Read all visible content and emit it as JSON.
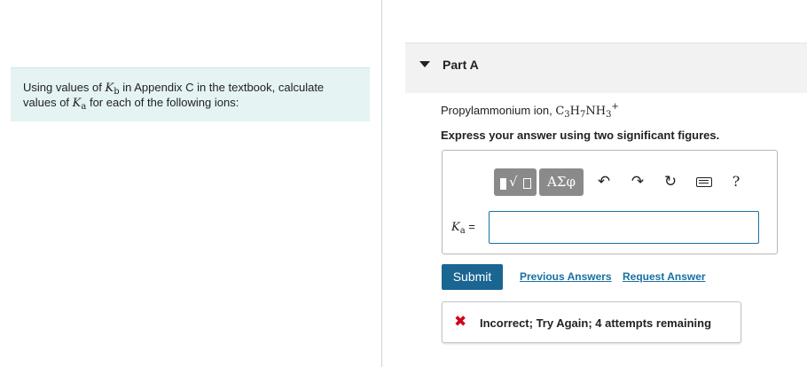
{
  "problem": {
    "text_before": "Using values of ",
    "kb_symbol": "K",
    "kb_subscript": "b",
    "text_middle": " in Appendix C in the textbook, calculate values of ",
    "ka_symbol": "K",
    "ka_subscript": "a",
    "text_after": " for each of the following ions:"
  },
  "part": {
    "title": "Part A",
    "question_prefix": "Propylammonium ion, ",
    "formula": {
      "c": "C",
      "c_sub": "3",
      "h": "H",
      "h_sub": "7",
      "n": "NH",
      "n_sub": "3",
      "charge": "+"
    },
    "instructions": "Express your answer using two significant figures."
  },
  "toolbar": {
    "templates_radical": "√",
    "greek_label": "ΑΣφ",
    "undo_icon": "↶",
    "redo_icon": "↷",
    "reset_icon": "↻",
    "help_label": "?"
  },
  "answer": {
    "label_symbol": "K",
    "label_subscript": "a",
    "label_equals": " = ",
    "value": ""
  },
  "actions": {
    "submit_label": "Submit",
    "previous_answers_label": "Previous Answers",
    "request_answer_label": "Request Answer"
  },
  "feedback": {
    "icon": "✖",
    "text": "Incorrect; Try Again; 4 attempts remaining"
  },
  "colors": {
    "problem_background": "#e5f3f3",
    "submit_background": "#1a6592",
    "link": "#1a6fa3",
    "error_icon": "#d0021b",
    "toolbar_button": "#8a8a8a"
  }
}
